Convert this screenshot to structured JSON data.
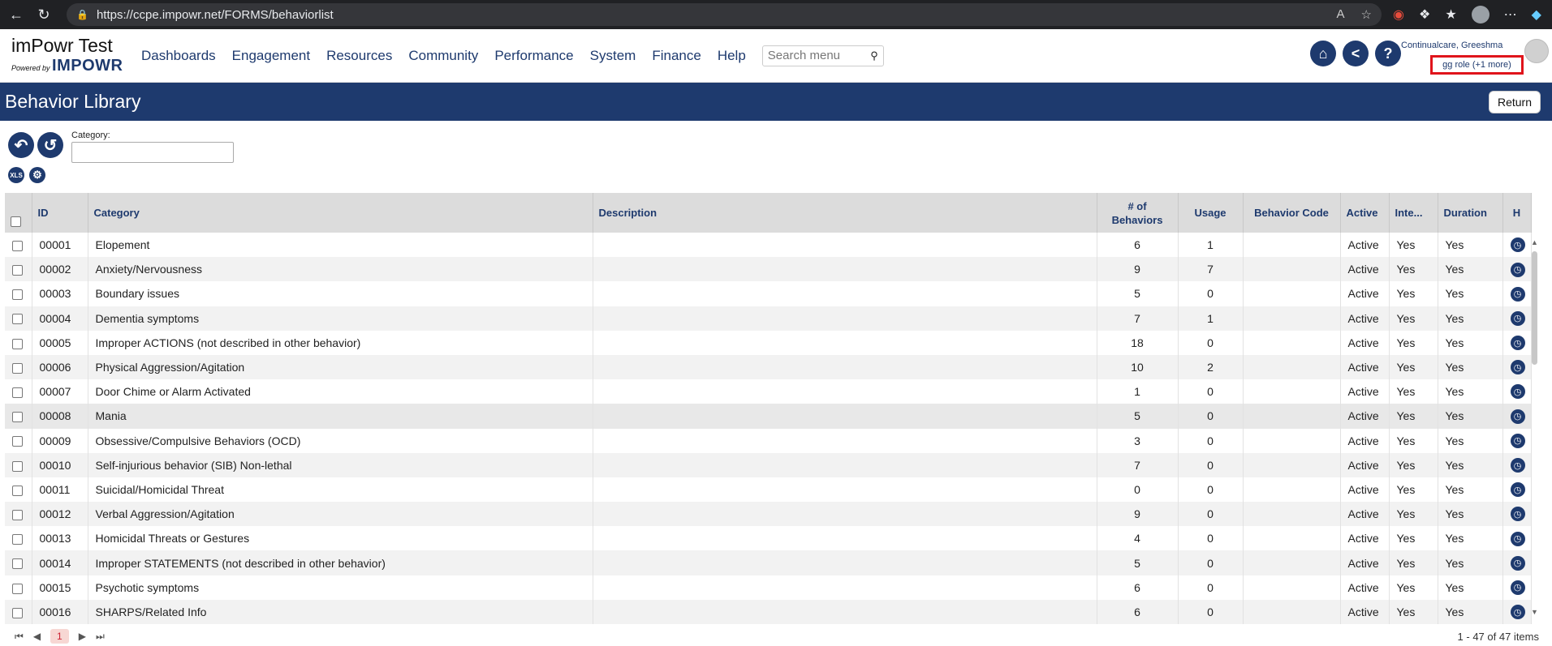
{
  "browser": {
    "url": "https://ccpe.impowr.net/FORMS/behaviorlist"
  },
  "app": {
    "title": "imPowr Test",
    "powered_by": "Powered by",
    "brand": "IMPOWR"
  },
  "nav": {
    "items": [
      "Dashboards",
      "Engagement",
      "Resources",
      "Community",
      "Performance",
      "System",
      "Finance",
      "Help"
    ],
    "search_placeholder": "Search menu"
  },
  "user": {
    "name": "Continualcare, Greeshma",
    "role": "gg role (+1 more)"
  },
  "page": {
    "title": "Behavior Library",
    "return_label": "Return"
  },
  "filter": {
    "category_label": "Category:"
  },
  "table": {
    "headers": [
      "ID",
      "Category",
      "Description",
      "# of Behaviors",
      "Usage",
      "Behavior Code",
      "Active",
      "Inte...",
      "Duration",
      "H"
    ],
    "rows": [
      [
        "00001",
        "Elopement",
        "",
        "6",
        "1",
        "",
        "Active",
        "Yes",
        "Yes"
      ],
      [
        "00002",
        "Anxiety/Nervousness",
        "",
        "9",
        "7",
        "",
        "Active",
        "Yes",
        "Yes"
      ],
      [
        "00003",
        "Boundary issues",
        "",
        "5",
        "0",
        "",
        "Active",
        "Yes",
        "Yes"
      ],
      [
        "00004",
        "Dementia symptoms",
        "",
        "7",
        "1",
        "",
        "Active",
        "Yes",
        "Yes"
      ],
      [
        "00005",
        "Improper ACTIONS (not described in other behavior)",
        "",
        "18",
        "0",
        "",
        "Active",
        "Yes",
        "Yes"
      ],
      [
        "00006",
        "Physical Aggression/Agitation",
        "",
        "10",
        "2",
        "",
        "Active",
        "Yes",
        "Yes"
      ],
      [
        "00007",
        "Door Chime or Alarm Activated",
        "",
        "1",
        "0",
        "",
        "Active",
        "Yes",
        "Yes"
      ],
      [
        "00008",
        "Mania",
        "",
        "5",
        "0",
        "",
        "Active",
        "Yes",
        "Yes"
      ],
      [
        "00009",
        "Obsessive/Compulsive Behaviors (OCD)",
        "",
        "3",
        "0",
        "",
        "Active",
        "Yes",
        "Yes"
      ],
      [
        "00010",
        "Self-injurious behavior (SIB) Non-lethal",
        "",
        "7",
        "0",
        "",
        "Active",
        "Yes",
        "Yes"
      ],
      [
        "00011",
        "Suicidal/Homicidal Threat",
        "",
        "0",
        "0",
        "",
        "Active",
        "Yes",
        "Yes"
      ],
      [
        "00012",
        "Verbal Aggression/Agitation",
        "",
        "9",
        "0",
        "",
        "Active",
        "Yes",
        "Yes"
      ],
      [
        "00013",
        "Homicidal Threats or Gestures",
        "",
        "4",
        "0",
        "",
        "Active",
        "Yes",
        "Yes"
      ],
      [
        "00014",
        "Improper STATEMENTS (not described in other behavior)",
        "",
        "5",
        "0",
        "",
        "Active",
        "Yes",
        "Yes"
      ],
      [
        "00015",
        "Psychotic symptoms",
        "",
        "6",
        "0",
        "",
        "Active",
        "Yes",
        "Yes"
      ],
      [
        "00016",
        "SHARPS/Related Info",
        "",
        "6",
        "0",
        "",
        "Active",
        "Yes",
        "Yes"
      ]
    ]
  },
  "pager": {
    "current_page": "1",
    "info": "1 - 47 of 47 items"
  },
  "colors": {
    "brand": "#1e3a6e",
    "highlight_box": "#e0141b"
  }
}
